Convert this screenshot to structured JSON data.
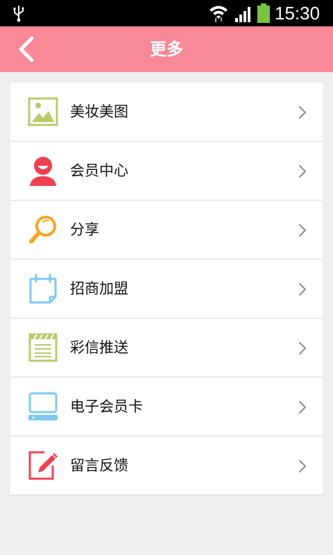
{
  "status_bar": {
    "time": "15:30",
    "icons": [
      "usb-icon",
      "wifi-icon",
      "signal-icon",
      "battery-icon"
    ],
    "battery_color": "#76c442"
  },
  "header": {
    "title": "更多",
    "back_icon": "chevron-left-icon",
    "background_color": "#f98996"
  },
  "menu": {
    "items": [
      {
        "label": "美妆美图",
        "icon": "image-icon"
      },
      {
        "label": "会员中心",
        "icon": "member-icon"
      },
      {
        "label": "分享",
        "icon": "magnifier-icon"
      },
      {
        "label": "招商加盟",
        "icon": "calendar-icon"
      },
      {
        "label": "彩信推送",
        "icon": "mms-icon"
      },
      {
        "label": "电子会员卡",
        "icon": "computer-icon"
      },
      {
        "label": "留言反馈",
        "icon": "feedback-icon"
      }
    ]
  }
}
